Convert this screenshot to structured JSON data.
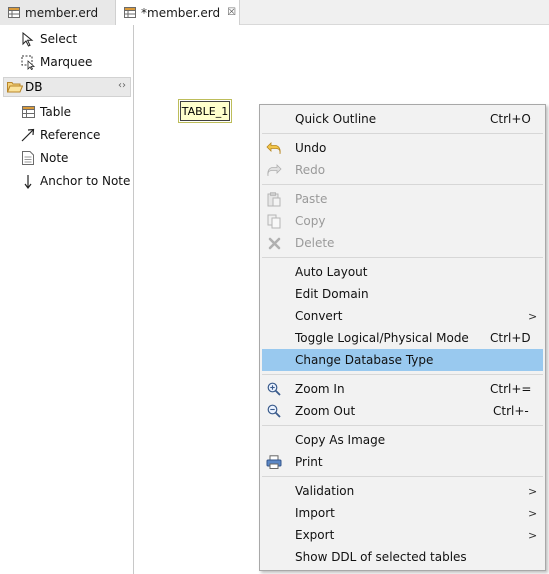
{
  "tabs": [
    {
      "label": "member.erd",
      "icon": "erd-table-icon"
    },
    {
      "label": "*member.erd",
      "icon": "erd-table-icon",
      "close": "☒"
    }
  ],
  "palette": {
    "tools": [
      {
        "label": "Select",
        "icon": "select-arrow-icon"
      },
      {
        "label": "Marquee",
        "icon": "marquee-icon"
      }
    ],
    "drawer": {
      "label": "DB",
      "icon": "folder-open-icon",
      "pin": "‹›"
    },
    "items": [
      {
        "label": "Table",
        "icon": "table-icon"
      },
      {
        "label": "Reference",
        "icon": "reference-arrow-icon"
      },
      {
        "label": "Note",
        "icon": "note-icon"
      },
      {
        "label": "Anchor to Note",
        "icon": "anchor-arrow-icon"
      }
    ]
  },
  "canvas": {
    "table_label": "TABLE_1"
  },
  "context_menu": {
    "items": [
      {
        "label": "Quick Outline",
        "shortcut": "Ctrl+O"
      },
      {
        "label": "Undo",
        "icon": "undo-icon"
      },
      {
        "label": "Redo",
        "icon": "redo-icon",
        "disabled": true
      },
      {
        "label": "Paste",
        "icon": "paste-icon",
        "disabled": true
      },
      {
        "label": "Copy",
        "icon": "copy-icon",
        "disabled": true
      },
      {
        "label": "Delete",
        "icon": "delete-icon",
        "disabled": true
      },
      {
        "label": "Auto Layout"
      },
      {
        "label": "Edit Domain"
      },
      {
        "label": "Convert",
        "submenu": ">"
      },
      {
        "label": "Toggle Logical/Physical Mode",
        "shortcut": "Ctrl+D"
      },
      {
        "label": "Change Database Type",
        "selected": true
      },
      {
        "label": "Zoom In",
        "icon": "zoom-in-icon",
        "shortcut": "Ctrl+="
      },
      {
        "label": "Zoom Out",
        "icon": "zoom-out-icon",
        "shortcut": "Ctrl+-"
      },
      {
        "label": "Copy As Image"
      },
      {
        "label": "Print",
        "icon": "printer-icon"
      },
      {
        "label": "Validation",
        "submenu": ">"
      },
      {
        "label": "Import",
        "submenu": ">"
      },
      {
        "label": "Export",
        "submenu": ">"
      },
      {
        "label": "Show DDL of selected tables"
      }
    ]
  },
  "colors": {
    "selection": "#99c9ef",
    "menu_bg": "#f2f2f2",
    "table_fill": "#ffffcc"
  }
}
